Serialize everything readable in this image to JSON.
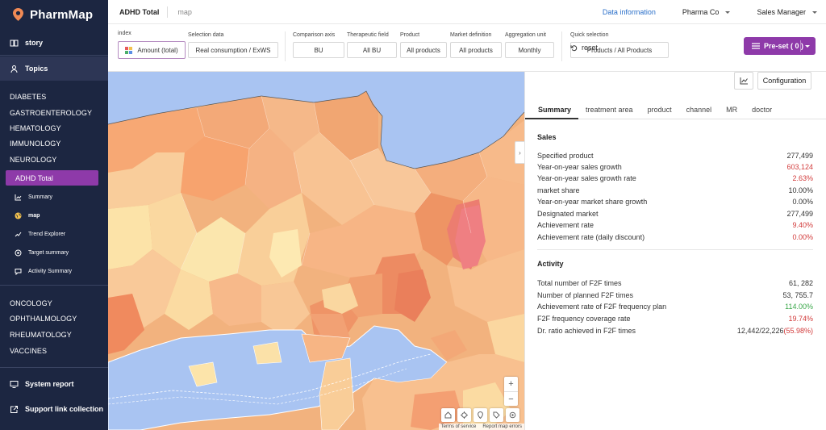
{
  "app": {
    "name": "PharmMap"
  },
  "sidebar": {
    "story": "story",
    "topics": "Topics",
    "categories_top": [
      "DIABETES",
      "GASTROENTEROLOGY",
      "HEMATOLOGY",
      "IMMUNOLOGY",
      "NEUROLOGY"
    ],
    "active_category": "ADHD  Total",
    "subitems": [
      "Summary",
      "map",
      "Trend Explorer",
      "Target summary",
      "Activity Summary"
    ],
    "categories_bottom": [
      "ONCOLOGY",
      "OPHTHALMOLOGY",
      "RHEUMATOLOGY",
      "VACCINES"
    ],
    "system_report": "System report",
    "support_links": "Support link collection"
  },
  "topbar": {
    "title": "ADHD Total",
    "subtitle": "map",
    "data_info": "Data information",
    "company": "Pharma Co",
    "role": "Sales Manager"
  },
  "filters": {
    "index_label": "index",
    "index_value": "Amount (total)",
    "selection_label": "Selection data",
    "selection_value": "Real consumption / ExWS",
    "comparison_label": "Comparison axis",
    "comparison_value": "BU",
    "therapeutic_label": "Therapeutic field",
    "therapeutic_value": "All BU",
    "product_label": "Product",
    "product_value": "All products",
    "market_label": "Market definition",
    "market_value": "All products",
    "aggregation_label": "Aggregation unit",
    "aggregation_value": "Monthly",
    "quick_label": "Quick selection",
    "quick_value": "Products / All Products",
    "reset": "reset",
    "preset": "Pre-set ( 0 )"
  },
  "map": {
    "zoom_in": "+",
    "zoom_out": "−",
    "terms": "Terms of service",
    "report": "Report map errors",
    "toggle": "›"
  },
  "panel": {
    "config_label": "Configuration",
    "tabs": [
      "Summary",
      "treatment area",
      "product",
      "channel",
      "MR",
      "doctor"
    ],
    "sales_title": "Sales",
    "sales": [
      {
        "label": "Specified product",
        "value": "277,499"
      },
      {
        "label": "Year-on-year sales growth",
        "value": "603,124"
      },
      {
        "label": "Year-on-year sales growth rate",
        "value": "2.63%"
      },
      {
        "label": "market share",
        "value": "10.00%"
      },
      {
        "label": "Year-on-year market share growth",
        "value": "0.00%"
      },
      {
        "label": "Designated market",
        "value": "277,499"
      },
      {
        "label": "Achievement rate",
        "value": "9.40%"
      },
      {
        "label": "Achievement rate (daily discount)",
        "value": "0.00%"
      }
    ],
    "activity_title": "Activity",
    "activity": [
      {
        "label": "Total number of F2F times",
        "value": "61, 282"
      },
      {
        "label": "Number of planned F2F times",
        "value": "53, 755.7"
      },
      {
        "label": "Achievement rate of F2F frequency plan",
        "value": "114.00%"
      },
      {
        "label": "F2F frequency coverage rate",
        "value": "19.74%"
      },
      {
        "label": "Dr. ratio achieved in F2F times",
        "value": "12,442/22,226",
        "value_extra": "(55.98%)"
      }
    ]
  },
  "colors": {
    "sidebar_bg": "#1c2641",
    "accent_purple": "#8e3aa9",
    "link_blue": "#2a6fc9",
    "negative_red": "#d23b3b",
    "positive_green": "#3aa84a",
    "water": "#a9c4f2"
  }
}
